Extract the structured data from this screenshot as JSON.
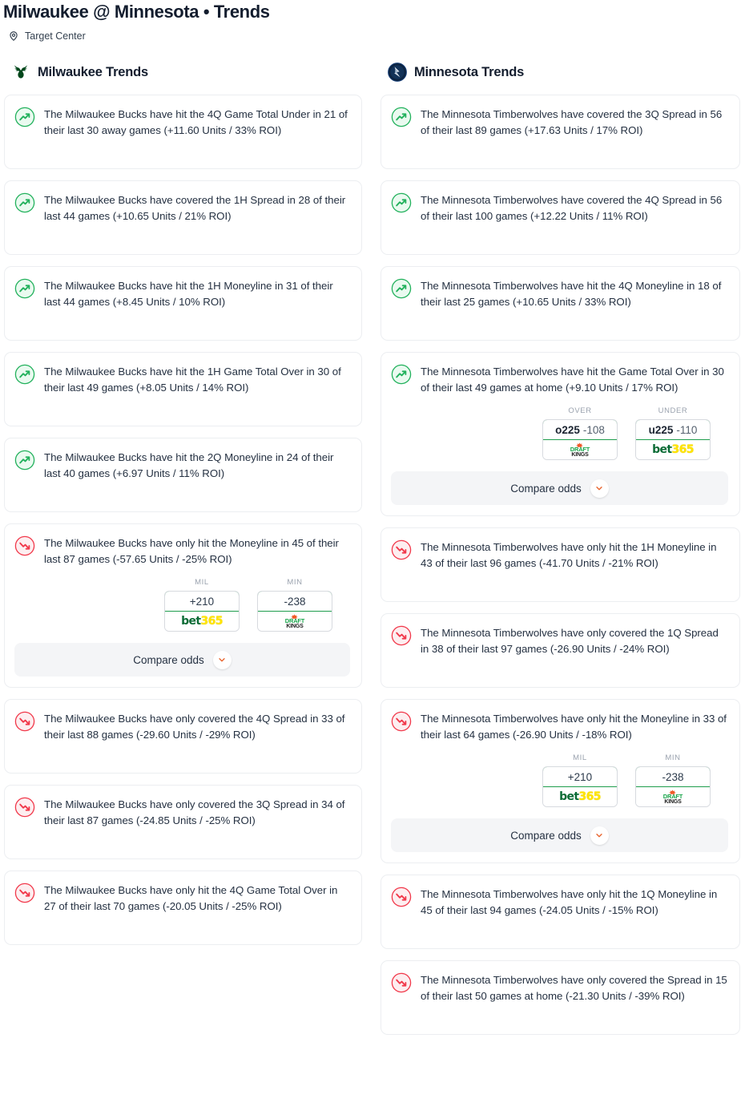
{
  "header": {
    "title": "Milwaukee @ Minnesota • Trends",
    "venue": "Target Center",
    "venue_icon": "location-pin-icon"
  },
  "colors": {
    "positive": "#22b15c",
    "negative": "#f1384a",
    "odds_border_green": "#1f9d4d",
    "chevron_orange": "#e8622a",
    "bet365_green": "#0a6b35",
    "bet365_yellow": "#ffe400",
    "draftkings_green": "#18a54a",
    "bucks_green": "#00471b",
    "wolves_navy": "#0c2340"
  },
  "compare_odds_label": "Compare odds",
  "columns": [
    {
      "id": "milwaukee",
      "heading": "Milwaukee Trends",
      "logo": "bucks-logo",
      "trends": [
        {
          "direction": "up",
          "text": "The Milwaukee Bucks have hit the 4Q Game Total Under in 21 of their last 30 away games (+11.60 Units / 33% ROI)"
        },
        {
          "direction": "up",
          "text": "The Milwaukee Bucks have covered the 1H Spread in 28 of their last 44 games (+10.65 Units / 21% ROI)"
        },
        {
          "direction": "up",
          "text": "The Milwaukee Bucks have hit the 1H Moneyline in 31 of their last 44 games (+8.45 Units / 10% ROI)"
        },
        {
          "direction": "up",
          "text": "The Milwaukee Bucks have hit the 1H Game Total Over in 30 of their last 49 games (+8.05 Units / 14% ROI)"
        },
        {
          "direction": "up",
          "text": "The Milwaukee Bucks have hit the 2Q Moneyline in 24 of their last 40 games (+6.97 Units / 11% ROI)"
        },
        {
          "direction": "down",
          "text": "The Milwaukee Bucks have only hit the Moneyline in 45 of their last 87 games (-57.65 Units / -25% ROI)",
          "odds": [
            {
              "label": "MIL",
              "line": "",
              "price": "+210",
              "book": "bet365"
            },
            {
              "label": "MIN",
              "line": "",
              "price": "-238",
              "book": "draftkings"
            }
          ]
        },
        {
          "direction": "down",
          "text": "The Milwaukee Bucks have only covered the 4Q Spread in 33 of their last 88 games (-29.60 Units / -29% ROI)"
        },
        {
          "direction": "down",
          "text": "The Milwaukee Bucks have only covered the 3Q Spread in 34 of their last 87 games (-24.85 Units / -25% ROI)"
        },
        {
          "direction": "down",
          "text": "The Milwaukee Bucks have only hit the 4Q Game Total Over in 27 of their last 70 games (-20.05 Units / -25% ROI)"
        }
      ]
    },
    {
      "id": "minnesota",
      "heading": "Minnesota Trends",
      "logo": "timberwolves-logo",
      "trends": [
        {
          "direction": "up",
          "text": "The Minnesota Timberwolves have covered the 3Q Spread in 56 of their last 89 games (+17.63 Units / 17% ROI)"
        },
        {
          "direction": "up",
          "text": "The Minnesota Timberwolves have covered the 4Q Spread in 56 of their last 100 games (+12.22 Units / 11% ROI)"
        },
        {
          "direction": "up",
          "text": "The Minnesota Timberwolves have hit the 4Q Moneyline in 18 of their last 25 games (+10.65 Units / 33% ROI)"
        },
        {
          "direction": "up",
          "text": "The Minnesota Timberwolves have hit the Game Total Over in 30 of their last 49 games at home (+9.10 Units / 17% ROI)",
          "odds": [
            {
              "label": "OVER",
              "line": "o225",
              "price": "-108",
              "book": "draftkings"
            },
            {
              "label": "UNDER",
              "line": "u225",
              "price": "-110",
              "book": "bet365"
            }
          ]
        },
        {
          "direction": "down",
          "text": "The Minnesota Timberwolves have only hit the 1H Moneyline in 43 of their last 96 games (-41.70 Units / -21% ROI)"
        },
        {
          "direction": "down",
          "text": "The Minnesota Timberwolves have only covered the 1Q Spread in 38 of their last 97 games (-26.90 Units / -24% ROI)"
        },
        {
          "direction": "down",
          "text": "The Minnesota Timberwolves have only hit the Moneyline in 33 of their last 64 games (-26.90 Units / -18% ROI)",
          "odds": [
            {
              "label": "MIL",
              "line": "",
              "price": "+210",
              "book": "bet365"
            },
            {
              "label": "MIN",
              "line": "",
              "price": "-238",
              "book": "draftkings"
            }
          ]
        },
        {
          "direction": "down",
          "text": "The Minnesota Timberwolves have only hit the 1Q Moneyline in 45 of their last 94 games (-24.05 Units / -15% ROI)"
        },
        {
          "direction": "down",
          "text": "The Minnesota Timberwolves have only covered the Spread in 15 of their last 50 games at home (-21.30 Units / -39% ROI)"
        }
      ]
    }
  ]
}
